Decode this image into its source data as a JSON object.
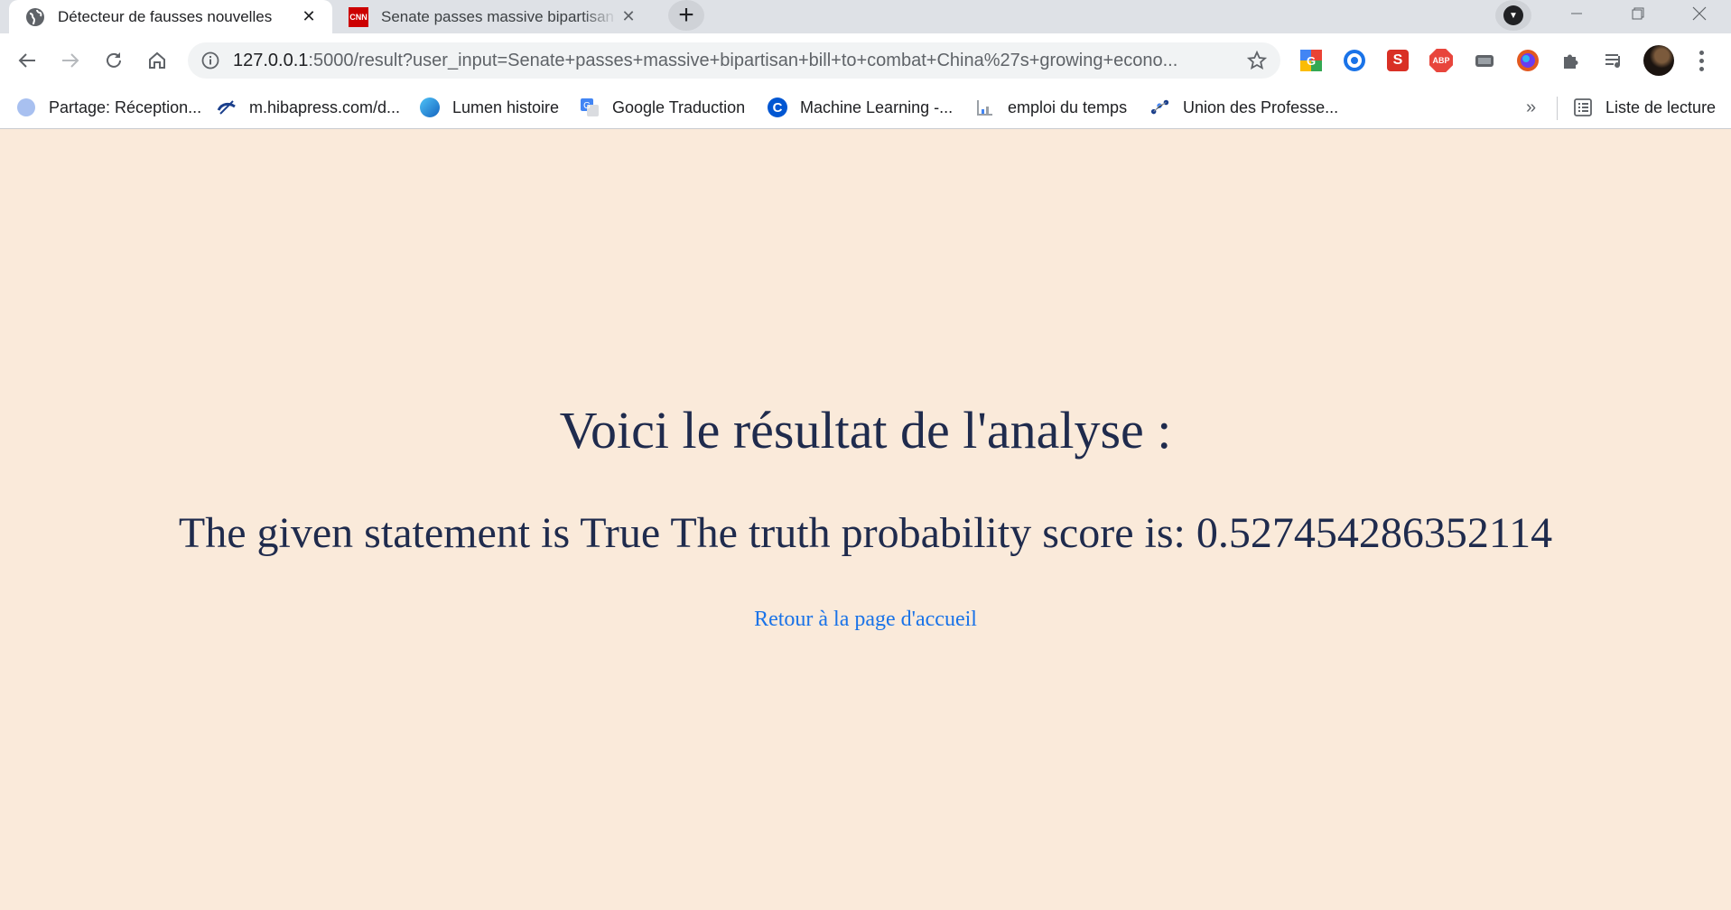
{
  "tabs": [
    {
      "title": "Détecteur de fausses nouvelles",
      "favicon": "globe-icon",
      "active": true
    },
    {
      "title": "Senate passes massive bipartisan bill to combat China's growing economic",
      "favicon": "cnn-icon",
      "favicon_text": "CNN",
      "active": false
    }
  ],
  "address_bar": {
    "host": "127.0.0.1",
    "rest": ":5000/result?user_input=Senate+passes+massive+bipartisan+bill+to+combat+China%27s+growing+econo..."
  },
  "extensions": [
    "google-icon",
    "compass-icon",
    "s-extension-icon",
    "adblock-icon",
    "gamepad-icon",
    "firefox-relay-icon",
    "puzzle-icon",
    "media-queue-icon"
  ],
  "extension_labels": {
    "s": "S",
    "abp": "ABP"
  },
  "bookmarks": [
    {
      "label": "Partage: Réception...",
      "icon": "drive-icon"
    },
    {
      "label": "m.hibapress.com/d...",
      "icon": "hibapress-icon"
    },
    {
      "label": "Lumen histoire",
      "icon": "lumen-icon"
    },
    {
      "label": "Google Traduction",
      "icon": "google-translate-icon"
    },
    {
      "label": "Machine Learning -...",
      "icon": "coursera-icon",
      "icon_text": "C"
    },
    {
      "label": "emploi du temps",
      "icon": "calendar-icon"
    },
    {
      "label": "Union des Professe...",
      "icon": "union-icon"
    }
  ],
  "bookmarks_more": "»",
  "reading_list": "Liste de lecture",
  "page": {
    "heading": "Voici le résultat de l'analyse :",
    "result": "The given statement is True The truth probability score is: 0.527454286352114",
    "back_link": "Retour à la page d'accueil"
  },
  "colors": {
    "page_background": "#faeada",
    "heading_text": "#1f2b4d",
    "link": "#1a73e8"
  }
}
